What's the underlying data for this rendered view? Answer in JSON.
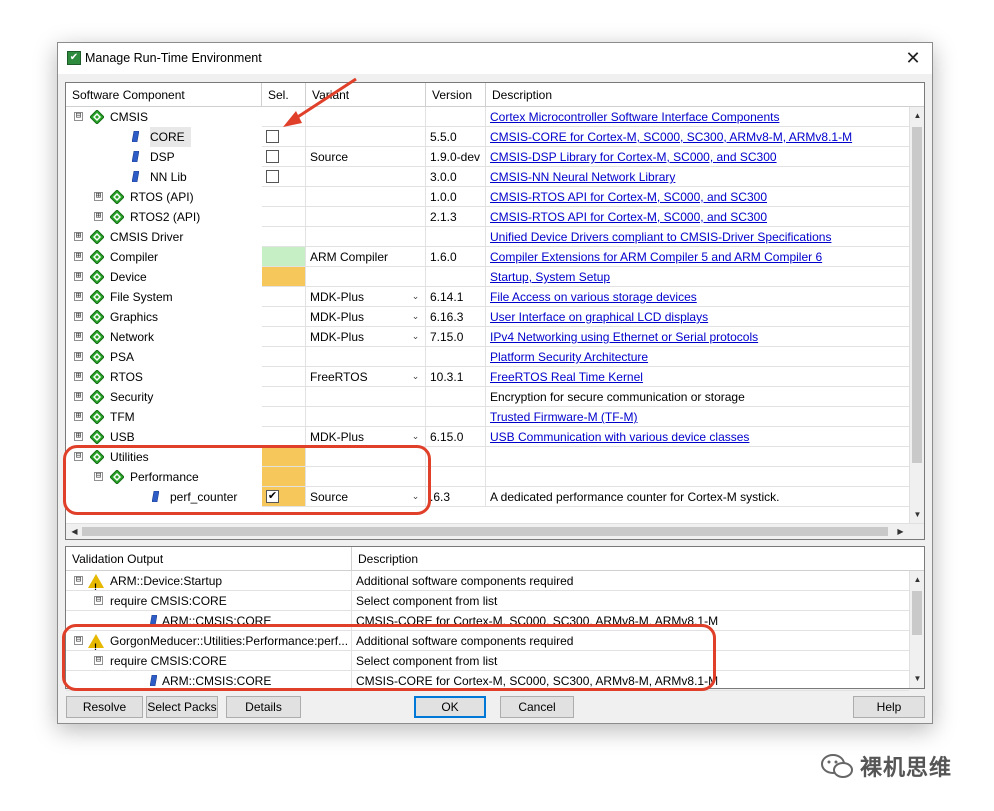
{
  "window": {
    "title": "Manage Run-Time Environment",
    "close_glyph": "✕",
    "app_icon": "green-check-icon"
  },
  "columns": {
    "component": "Software Component",
    "sel": "Sel.",
    "variant": "Variant",
    "version": "Version",
    "description": "Description"
  },
  "components": [
    {
      "label": "CMSIS",
      "expander": "⊟",
      "icon": "green-diamond-icon",
      "sel": "",
      "checkbox": false,
      "checked": false,
      "variant": "",
      "dropdown": false,
      "version": "",
      "desc": "Cortex Microcontroller Software Interface Components",
      "link": true
    },
    {
      "label": "CORE",
      "expander": "",
      "icon": "blue-component-icon",
      "sel": "",
      "checkbox": true,
      "checked": false,
      "variant": "",
      "dropdown": false,
      "version": "5.5.0",
      "desc": "CMSIS-CORE for Cortex-M, SC000, SC300, ARMv8-M, ARMv8.1-M",
      "link": true
    },
    {
      "label": "DSP",
      "expander": "",
      "icon": "blue-component-icon",
      "sel": "",
      "checkbox": true,
      "checked": false,
      "variant": "Source",
      "dropdown": false,
      "version": "1.9.0-dev",
      "desc": "CMSIS-DSP Library for Cortex-M, SC000, and SC300",
      "link": true
    },
    {
      "label": "NN Lib",
      "expander": "",
      "icon": "blue-component-icon",
      "sel": "",
      "checkbox": true,
      "checked": false,
      "variant": "",
      "dropdown": false,
      "version": "3.0.0",
      "desc": "CMSIS-NN Neural Network Library",
      "link": true
    },
    {
      "label": "RTOS (API)",
      "expander": "⊞",
      "icon": "green-diamond-icon",
      "sel": "",
      "checkbox": false,
      "checked": false,
      "variant": "",
      "dropdown": false,
      "version": "1.0.0",
      "desc": "CMSIS-RTOS API for Cortex-M, SC000, and SC300",
      "link": true
    },
    {
      "label": "RTOS2 (API)",
      "expander": "⊞",
      "icon": "green-diamond-icon",
      "sel": "",
      "checkbox": false,
      "checked": false,
      "variant": "",
      "dropdown": false,
      "version": "2.1.3",
      "desc": "CMSIS-RTOS API for Cortex-M, SC000, and SC300",
      "link": true
    },
    {
      "label": "CMSIS Driver",
      "expander": "⊞",
      "icon": "green-diamond-icon",
      "sel": "",
      "checkbox": false,
      "checked": false,
      "variant": "",
      "dropdown": false,
      "version": "",
      "desc": "Unified Device Drivers compliant to CMSIS-Driver Specifications",
      "link": true
    },
    {
      "label": "Compiler",
      "expander": "⊞",
      "icon": "green-diamond-icon",
      "sel": "green",
      "checkbox": false,
      "checked": false,
      "variant": "ARM Compiler",
      "dropdown": false,
      "version": "1.6.0",
      "desc": "Compiler Extensions for ARM Compiler 5 and ARM Compiler 6",
      "link": true
    },
    {
      "label": "Device",
      "expander": "⊞",
      "icon": "green-diamond-icon",
      "sel": "orange",
      "checkbox": false,
      "checked": false,
      "variant": "",
      "dropdown": false,
      "version": "",
      "desc": "Startup, System Setup",
      "link": true
    },
    {
      "label": "File System",
      "expander": "⊞",
      "icon": "green-diamond-icon",
      "sel": "",
      "checkbox": false,
      "checked": false,
      "variant": "MDK-Plus",
      "dropdown": true,
      "version": "6.14.1",
      "desc": "File Access on various storage devices",
      "link": true
    },
    {
      "label": "Graphics",
      "expander": "⊞",
      "icon": "green-diamond-icon",
      "sel": "",
      "checkbox": false,
      "checked": false,
      "variant": "MDK-Plus",
      "dropdown": true,
      "version": "6.16.3",
      "desc": "User Interface on graphical LCD displays",
      "link": true
    },
    {
      "label": "Network",
      "expander": "⊞",
      "icon": "green-diamond-icon",
      "sel": "",
      "checkbox": false,
      "checked": false,
      "variant": "MDK-Plus",
      "dropdown": true,
      "version": "7.15.0",
      "desc": "IPv4 Networking using Ethernet or Serial protocols",
      "link": true
    },
    {
      "label": "PSA",
      "expander": "⊞",
      "icon": "green-diamond-icon",
      "sel": "",
      "checkbox": false,
      "checked": false,
      "variant": "",
      "dropdown": false,
      "version": "",
      "desc": "Platform Security Architecture",
      "link": true
    },
    {
      "label": "RTOS",
      "expander": "⊞",
      "icon": "green-diamond-icon",
      "sel": "",
      "checkbox": false,
      "checked": false,
      "variant": "FreeRTOS",
      "dropdown": true,
      "version": "10.3.1",
      "desc": "FreeRTOS Real Time Kernel",
      "link": true
    },
    {
      "label": "Security",
      "expander": "⊞",
      "icon": "green-diamond-icon",
      "sel": "",
      "checkbox": false,
      "checked": false,
      "variant": "",
      "dropdown": false,
      "version": "",
      "desc": "Encryption for secure communication or storage",
      "link": false
    },
    {
      "label": "TFM",
      "expander": "⊞",
      "icon": "green-diamond-icon",
      "sel": "",
      "checkbox": false,
      "checked": false,
      "variant": "",
      "dropdown": false,
      "version": "",
      "desc": "Trusted Firmware-M (TF-M)",
      "link": true
    },
    {
      "label": "USB",
      "expander": "⊞",
      "icon": "green-diamond-icon",
      "sel": "",
      "checkbox": false,
      "checked": false,
      "variant": "MDK-Plus",
      "dropdown": true,
      "version": "6.15.0",
      "desc": "USB Communication with various device classes",
      "link": true
    },
    {
      "label": "Utilities",
      "expander": "⊟",
      "icon": "green-diamond-icon",
      "sel": "orange",
      "checkbox": false,
      "checked": false,
      "variant": "",
      "dropdown": false,
      "version": "",
      "desc": "",
      "link": false
    },
    {
      "label": "Performance",
      "expander": "⊟",
      "icon": "green-diamond-icon",
      "sel": "orange",
      "checkbox": false,
      "checked": false,
      "variant": "",
      "dropdown": false,
      "version": "",
      "desc": "",
      "link": false
    },
    {
      "label": "perf_counter",
      "expander": "",
      "icon": "blue-component-icon",
      "sel": "orange",
      "checkbox": true,
      "checked": true,
      "variant": "Source",
      "dropdown": true,
      "version": ".6.3",
      "desc": "A dedicated performance counter for Cortex-M systick.",
      "link": false
    }
  ],
  "validation": {
    "columns": {
      "output": "Validation Output",
      "description": "Description"
    },
    "rows": [
      {
        "label": "ARM::Device:Startup",
        "expander": "⊟",
        "icon": "warning-icon",
        "desc": "Additional software components required"
      },
      {
        "label": "require CMSIS:CORE",
        "expander": "⊟",
        "icon": "",
        "desc": "Select component from list"
      },
      {
        "label": "ARM::CMSIS:CORE",
        "expander": "",
        "icon": "blue-component-icon",
        "desc": "CMSIS-CORE for Cortex-M, SC000, SC300, ARMv8-M, ARMv8.1-M"
      },
      {
        "label": "GorgonMeducer::Utilities:Performance:perf...",
        "expander": "⊟",
        "icon": "warning-icon",
        "desc": "Additional software components required"
      },
      {
        "label": "require CMSIS:CORE",
        "expander": "⊟",
        "icon": "",
        "desc": "Select component from list"
      },
      {
        "label": "ARM::CMSIS:CORE",
        "expander": "",
        "icon": "blue-component-icon",
        "desc": "CMSIS-CORE for Cortex-M, SC000, SC300, ARMv8-M, ARMv8.1-M"
      }
    ]
  },
  "buttons": {
    "resolve": "Resolve",
    "select_packs": "Select Packs",
    "details": "Details",
    "ok": "OK",
    "cancel": "Cancel",
    "help": "Help"
  },
  "scroll_glyphs": {
    "up": "▲",
    "down": "▼",
    "left": "◀",
    "right": "▶",
    "dropdown": "⌄"
  },
  "watermark": {
    "text": "裸机思维",
    "icon": "wechat-icon"
  },
  "colors": {
    "sel_green": "#c6efc6",
    "sel_orange": "#f6c75a",
    "link": "#0000cc",
    "annotation_red": "#e0402a",
    "diamond_green": "#2aa52a"
  }
}
